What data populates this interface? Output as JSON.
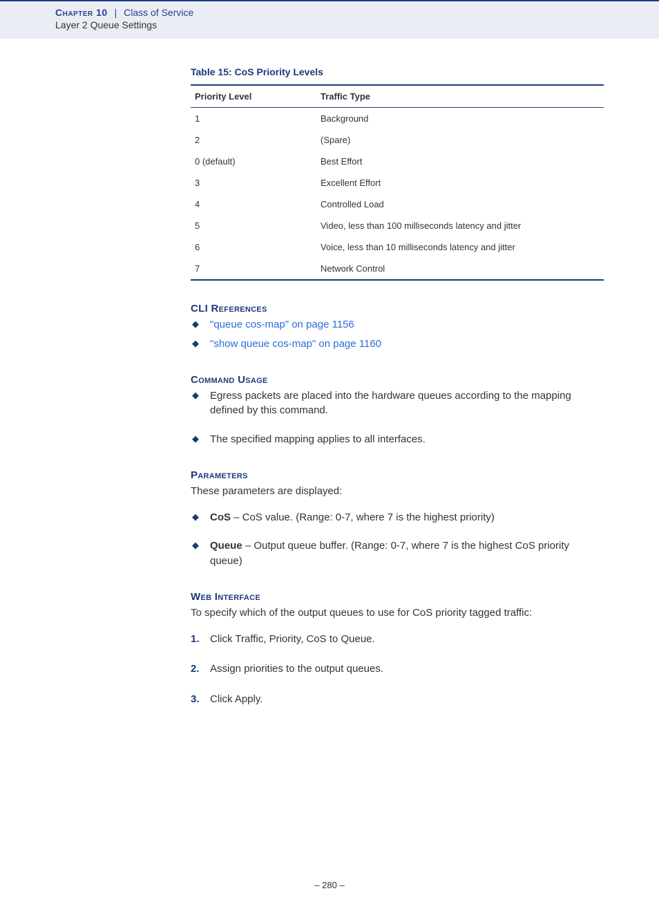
{
  "header": {
    "chapter_prefix": "Chapter 10",
    "separator": "|",
    "chapter_title": "Class of Service",
    "sub_title": "Layer 2 Queue Settings"
  },
  "table": {
    "caption": "Table 15: CoS Priority Levels",
    "columns": [
      "Priority Level",
      "Traffic Type"
    ],
    "rows": [
      {
        "level": "1",
        "type": "Background"
      },
      {
        "level": "2",
        "type": "(Spare)"
      },
      {
        "level": "0 (default)",
        "type": "Best Effort"
      },
      {
        "level": "3",
        "type": "Excellent Effort"
      },
      {
        "level": "4",
        "type": "Controlled Load"
      },
      {
        "level": "5",
        "type": "Video, less than 100 milliseconds latency and jitter"
      },
      {
        "level": "6",
        "type": "Voice, less than 10 milliseconds latency and jitter"
      },
      {
        "level": "7",
        "type": "Network Control"
      }
    ]
  },
  "cli_refs": {
    "title": "CLI References",
    "items": [
      "\"queue cos-map\" on page 1156",
      "\"show queue cos-map\" on page 1160"
    ]
  },
  "command_usage": {
    "title": "Command Usage",
    "items": [
      "Egress packets are placed into the hardware queues according to the mapping defined by this command.",
      "The specified mapping applies to all interfaces."
    ]
  },
  "parameters": {
    "title": "Parameters",
    "intro": "These parameters are displayed:",
    "items": [
      {
        "name": "CoS",
        "desc": " – CoS value. (Range: 0-7, where 7 is the highest priority)"
      },
      {
        "name": "Queue",
        "desc": " – Output queue buffer. (Range: 0-7, where 7 is the highest CoS priority queue)"
      }
    ]
  },
  "web_interface": {
    "title": "Web Interface",
    "intro": "To specify which of the output queues to use for CoS priority tagged traffic:",
    "steps": [
      "Click Traffic, Priority, CoS to Queue.",
      "Assign priorities to the output queues.",
      "Click Apply."
    ]
  },
  "page_number": "– 280 –",
  "chart_data": {
    "type": "table",
    "title": "Table 15: CoS Priority Levels",
    "columns": [
      "Priority Level",
      "Traffic Type"
    ],
    "rows": [
      [
        "1",
        "Background"
      ],
      [
        "2",
        "(Spare)"
      ],
      [
        "0 (default)",
        "Best Effort"
      ],
      [
        "3",
        "Excellent Effort"
      ],
      [
        "4",
        "Controlled Load"
      ],
      [
        "5",
        "Video, less than 100 milliseconds latency and jitter"
      ],
      [
        "6",
        "Voice, less than 10 milliseconds latency and jitter"
      ],
      [
        "7",
        "Network Control"
      ]
    ]
  }
}
